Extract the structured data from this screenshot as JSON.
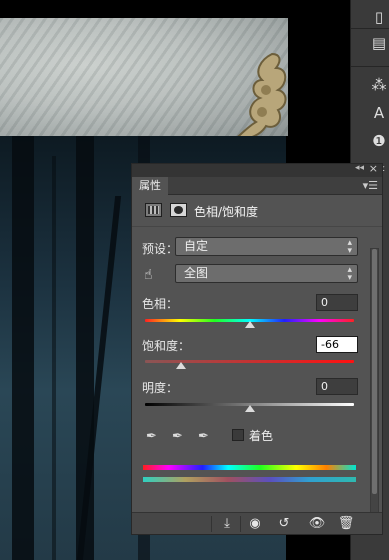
{
  "panel": {
    "tab_label": "属性",
    "header_title": "色相/饱和度",
    "preset_label": "预设：",
    "preset_value": "自定",
    "range_value": "全图",
    "hue": {
      "label": "色相：",
      "value": "0",
      "position_fraction": 0.5
    },
    "saturation": {
      "label": "饱和度：",
      "value": "-66",
      "position_fraction": 0.17
    },
    "lightness": {
      "label": "明度：",
      "value": "0",
      "position_fraction": 0.5
    },
    "colorize_label": "着色"
  },
  "icons": {
    "collapse": "double-chevron-icon",
    "close": "close-icon",
    "panel_menu": "panel-menu-icon",
    "hand_tool": "targeted-adjustment-hand-icon",
    "eyedropper": "eyedropper-icon",
    "eyedropper_add": "eyedropper-plus-icon",
    "eyedropper_subtract": "eyedropper-minus-icon",
    "clip": "clip-to-layer-icon",
    "view_previous": "view-previous-icon",
    "reset": "reset-icon",
    "visibility": "eye-icon",
    "delete": "trash-icon"
  },
  "colors": {
    "panel_bg": "#535353",
    "active_input_bg": "#ffffff"
  }
}
